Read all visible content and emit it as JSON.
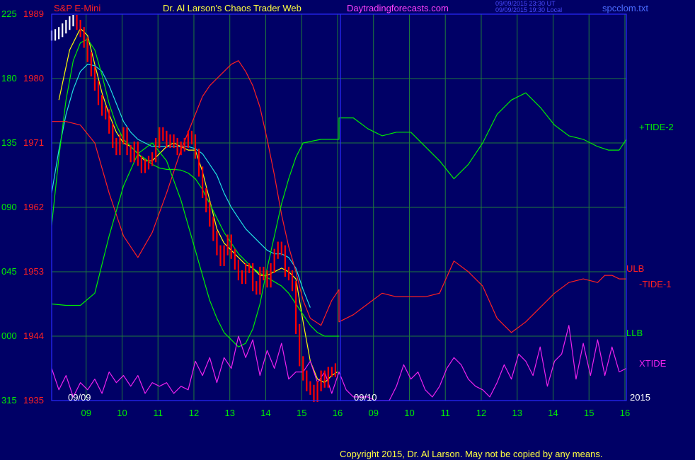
{
  "header": {
    "symbol": "S&P E-Mini",
    "author": "Dr. Al Larson's Chaos Trader Web",
    "site": "Daytradingforecasts.com",
    "stamp_line1": "09/09/2015 23:30 UT",
    "stamp_line2": "09/09/2015 19:30 Local",
    "file": "spcclom.txt"
  },
  "footer": {
    "copyright": "Copyright 2015, Dr. Al Larson. May not be copied by any means."
  },
  "chart_data": {
    "type": "line",
    "title": "Dr. Al Larson's Chaos Trader Web",
    "subtitle": "S&P E-Mini",
    "y_left_ticks": [
      "225",
      "180",
      "135",
      "090",
      "045",
      "000",
      "315"
    ],
    "y_price_ticks": [
      "1989",
      "1980",
      "1971",
      "1962",
      "1953",
      "1944",
      "1935"
    ],
    "price_range": [
      1935,
      1989
    ],
    "x_ticks": [
      "09",
      "10",
      "11",
      "12",
      "13",
      "14",
      "15",
      "16",
      "09",
      "10",
      "11",
      "12",
      "13",
      "14",
      "15",
      "16"
    ],
    "date_labels": [
      "09/09",
      "09/10"
    ],
    "year_label": "2015",
    "right_labels": [
      {
        "text": "+TIDE-2",
        "color": "#00ee00"
      },
      {
        "text": "ULB",
        "color": "#ff2020"
      },
      {
        "text": "-TIDE-1",
        "color": "#ff2020"
      },
      {
        "text": "LLB",
        "color": "#00ee00"
      },
      {
        "text": "XTIDE",
        "color": "#ee22ee"
      }
    ],
    "colors": {
      "background": "#000066",
      "plot_border": "#2a2aff",
      "grid": "#1f7a3c",
      "axis_text": "#00ee00",
      "price_text": "#ff2020",
      "header_text": "#ffff40",
      "site_text": "#ff40ff",
      "stamp_text": "#4a4aff",
      "file_text": "#4a6aff",
      "footer_text": "#ffff40",
      "bars_up": "#ffffff",
      "bars_down": "#ff0000"
    },
    "series": [
      {
        "name": "Price",
        "color": "#ff0000",
        "x": [
          0.0,
          0.1,
          0.2,
          0.3,
          0.4,
          0.5,
          0.6,
          0.7,
          0.8,
          0.9,
          1.0,
          1.1,
          1.2,
          1.3,
          1.4,
          1.5,
          1.6,
          1.7,
          1.8,
          1.9,
          2.0,
          2.1,
          2.2,
          2.3,
          2.4,
          2.5,
          2.6,
          2.7,
          2.8,
          2.9,
          3.0,
          3.1,
          3.2,
          3.3,
          3.4,
          3.5,
          3.6,
          3.7,
          3.8,
          3.9,
          4.0,
          4.1,
          4.2,
          4.3,
          4.4,
          4.5,
          4.6,
          4.7,
          4.8,
          4.9,
          5.0,
          5.1,
          5.2,
          5.3,
          5.4,
          5.5,
          5.6,
          5.7,
          5.8,
          5.9,
          6.0,
          6.1,
          6.2,
          6.3,
          6.4,
          6.5,
          6.6,
          6.7,
          6.8,
          6.9,
          7.0,
          7.1,
          7.2,
          7.3,
          7.4,
          7.5,
          7.6,
          7.7,
          7.8,
          7.9
        ],
        "y": [
          1986.0,
          1986.2,
          1986.5,
          1987.0,
          1987.5,
          1988.0,
          1988.2,
          1987.5,
          1986.5,
          1985.0,
          1983.0,
          1981.0,
          1979.0,
          1977.0,
          1975.5,
          1975.0,
          1973.0,
          1971.0,
          1970.0,
          1971.5,
          1972.5,
          1970.0,
          1969.0,
          1970.5,
          1968.5,
          1967.5,
          1968.0,
          1968.5,
          1969.0,
          1971.0,
          1972.5,
          1972.0,
          1971.0,
          1971.5,
          1971.0,
          1970.0,
          1970.5,
          1971.0,
          1972.0,
          1971.5,
          1969.5,
          1967.0,
          1964.0,
          1962.0,
          1960.0,
          1958.0,
          1956.0,
          1954.5,
          1956.0,
          1957.5,
          1955.5,
          1954.0,
          1952.5,
          1952.0,
          1953.5,
          1953.5,
          1951.0,
          1950.5,
          1953.0,
          1952.5,
          1951.5,
          1953.5,
          1955.5,
          1956.5,
          1956.0,
          1953.0,
          1952.5,
          1951.0,
          1945.0,
          1940.5,
          1938.5,
          1937.0,
          1936.5,
          1935.5,
          1937.0,
          1938.5,
          1937.5,
          1939.0,
          1939.0,
          1939.5
        ]
      },
      {
        "name": "Fast average",
        "color": "#ffff00",
        "x": [
          0.2,
          0.5,
          0.8,
          1.0,
          1.2,
          1.4,
          1.6,
          1.8,
          2.0,
          2.2,
          2.4,
          2.6,
          2.8,
          3.0,
          3.2,
          3.4,
          3.6,
          3.8,
          4.0,
          4.2,
          4.4,
          4.6,
          4.8,
          5.0,
          5.2,
          5.4,
          5.6,
          5.8,
          6.0,
          6.2,
          6.4,
          6.6,
          6.8,
          7.0,
          7.2,
          7.4,
          7.6,
          7.8,
          7.95
        ],
        "y": [
          1977.0,
          1984.0,
          1987.0,
          1986.0,
          1982.0,
          1978.0,
          1975.0,
          1972.5,
          1971.0,
          1970.5,
          1969.5,
          1968.5,
          1968.5,
          1969.5,
          1970.5,
          1971.0,
          1970.5,
          1970.0,
          1970.0,
          1967.0,
          1963.0,
          1959.0,
          1957.0,
          1956.0,
          1955.0,
          1954.0,
          1953.5,
          1952.5,
          1952.5,
          1953.0,
          1953.5,
          1953.0,
          1952.0,
          1946.0,
          1940.5,
          1938.0,
          1937.5,
          1938.5,
          1939.0
        ]
      },
      {
        "name": "Cyan average",
        "color": "#20e0e0",
        "x": [
          0.0,
          0.2,
          0.4,
          0.6,
          0.8,
          1.0,
          1.2,
          1.4,
          1.6,
          1.8,
          2.0,
          2.2,
          2.4,
          2.6,
          2.8,
          3.0,
          3.2,
          3.4,
          3.6,
          3.8,
          4.0,
          4.2,
          4.4,
          4.6,
          4.8,
          5.0,
          5.2,
          5.4,
          5.6,
          5.8,
          6.0,
          6.2,
          6.4,
          6.6,
          6.8,
          7.0,
          7.2
        ],
        "y": [
          1964.0,
          1970.0,
          1975.0,
          1978.5,
          1981.0,
          1982.0,
          1981.8,
          1981.0,
          1979.0,
          1976.5,
          1974.0,
          1972.5,
          1971.5,
          1971.0,
          1970.5,
          1970.5,
          1970.5,
          1970.5,
          1970.5,
          1970.5,
          1970.2,
          1969.5,
          1968.0,
          1966.5,
          1964.0,
          1962.0,
          1960.5,
          1959.0,
          1958.0,
          1957.0,
          1956.0,
          1955.5,
          1955.5,
          1955.0,
          1953.5,
          1950.5,
          1948.0
        ]
      },
      {
        "name": "Slow average",
        "color": "#00ee00",
        "x": [
          0.0,
          0.2,
          0.4,
          0.6,
          0.8,
          1.0,
          1.2,
          1.4,
          1.6,
          1.8,
          2.0,
          2.2,
          2.4,
          2.6,
          2.8,
          3.0,
          3.2,
          3.4,
          3.6,
          3.8,
          4.0,
          4.2,
          4.4,
          4.6,
          4.8,
          5.0,
          5.2,
          5.4,
          5.6,
          5.8,
          6.0,
          6.2,
          6.4,
          6.6,
          6.8,
          7.0,
          7.2,
          7.4,
          7.6,
          7.8,
          8.0
        ],
        "y": [
          1959.5,
          1969.0,
          1977.0,
          1982.5,
          1985.0,
          1985.5,
          1984.0,
          1980.5,
          1976.5,
          1973.5,
          1971.5,
          1970.5,
          1969.5,
          1968.8,
          1968.0,
          1967.5,
          1967.3,
          1967.3,
          1967.2,
          1966.8,
          1966.0,
          1964.5,
          1962.5,
          1960.5,
          1958.5,
          1957.0,
          1955.5,
          1954.5,
          1953.5,
          1952.8,
          1952.2,
          1951.6,
          1951.0,
          1950.0,
          1948.5,
          1947.0,
          1945.5,
          1944.5,
          1944.0,
          1944.0,
          1944.0
        ]
      },
      {
        "name": "-TIDE-1",
        "color": "#ff2020",
        "x": [
          0.0,
          0.4,
          0.8,
          1.2,
          1.6,
          2.0,
          2.4,
          2.8,
          3.2,
          3.6,
          4.0,
          4.2,
          4.4,
          4.6,
          4.8,
          5.0,
          5.2,
          5.4,
          5.6,
          5.8,
          6.0,
          6.2,
          6.4,
          6.6,
          6.8,
          7.0,
          7.2,
          7.5,
          7.8,
          8.0,
          8.0,
          8.4,
          8.8,
          9.2,
          9.6,
          10.0,
          10.4,
          10.8,
          11.2,
          11.6,
          12.0,
          12.4,
          12.8,
          13.2,
          13.6,
          14.0,
          14.4,
          14.8,
          15.2,
          15.4,
          15.6,
          15.8,
          16.0
        ],
        "y": [
          1974.0,
          1974.0,
          1973.5,
          1971.0,
          1964.0,
          1958.0,
          1955.0,
          1958.5,
          1964.0,
          1970.0,
          1975.0,
          1977.5,
          1979.0,
          1980.0,
          1981.0,
          1982.0,
          1982.5,
          1981.0,
          1979.0,
          1976.0,
          1971.5,
          1966.5,
          1961.0,
          1956.5,
          1953.0,
          1949.0,
          1946.5,
          1945.5,
          1949.0,
          1950.5,
          1946.0,
          1947.0,
          1948.5,
          1950.0,
          1949.5,
          1949.5,
          1949.5,
          1950.0,
          1954.5,
          1953.0,
          1951.0,
          1946.5,
          1944.5,
          1946.0,
          1948.0,
          1950.0,
          1951.5,
          1952.0,
          1951.5,
          1952.5,
          1952.5,
          1952.0,
          1952.0
        ]
      },
      {
        "name": "+TIDE-2",
        "color": "#00ee00",
        "x": [
          0.0,
          0.4,
          0.8,
          1.2,
          1.6,
          2.0,
          2.4,
          2.8,
          3.2,
          3.6,
          4.0,
          4.2,
          4.4,
          4.6,
          4.8,
          5.0,
          5.2,
          5.4,
          5.6,
          5.8,
          6.0,
          6.2,
          6.4,
          6.6,
          6.8,
          7.0,
          7.5,
          7.9,
          8.0,
          8.0,
          8.4,
          8.8,
          9.2,
          9.6,
          10.0,
          10.4,
          10.8,
          11.2,
          11.6,
          12.0,
          12.4,
          12.8,
          13.2,
          13.6,
          14.0,
          14.4,
          14.8,
          15.2,
          15.5,
          15.8,
          16.0
        ],
        "y": [
          1948.5,
          1948.3,
          1948.3,
          1950.0,
          1958.0,
          1965.0,
          1969.5,
          1971.0,
          1968.5,
          1963.0,
          1956.0,
          1952.5,
          1949.0,
          1946.5,
          1944.5,
          1943.5,
          1942.5,
          1943.0,
          1945.0,
          1948.5,
          1953.5,
          1958.0,
          1962.5,
          1966.0,
          1969.0,
          1971.0,
          1971.5,
          1971.5,
          1971.5,
          1974.5,
          1974.5,
          1973.0,
          1972.0,
          1972.5,
          1972.5,
          1970.5,
          1968.5,
          1966.0,
          1968.0,
          1971.0,
          1975.0,
          1977.0,
          1978.0,
          1976.0,
          1973.5,
          1972.0,
          1971.5,
          1970.5,
          1970.0,
          1970.0,
          1971.5
        ]
      },
      {
        "name": "XTIDE",
        "color": "#ee22ee",
        "x": [
          0.0,
          0.2,
          0.4,
          0.6,
          0.8,
          1.0,
          1.2,
          1.4,
          1.6,
          1.8,
          2.0,
          2.2,
          2.4,
          2.6,
          2.8,
          3.0,
          3.2,
          3.4,
          3.6,
          3.8,
          4.0,
          4.2,
          4.4,
          4.6,
          4.8,
          5.0,
          5.2,
          5.4,
          5.6,
          5.8,
          6.0,
          6.2,
          6.4,
          6.6,
          6.8,
          7.0,
          7.2,
          7.4,
          7.6,
          7.8,
          8.0,
          8.2,
          8.4,
          8.6,
          8.8,
          9.0,
          9.2,
          9.4,
          9.6,
          9.8,
          10.0,
          10.2,
          10.4,
          10.6,
          10.8,
          11.0,
          11.2,
          11.4,
          11.6,
          11.8,
          12.0,
          12.2,
          12.4,
          12.6,
          12.8,
          13.0,
          13.2,
          13.4,
          13.6,
          13.8,
          14.0,
          14.2,
          14.4,
          14.6,
          14.8,
          15.0,
          15.2,
          15.4,
          15.6,
          15.8,
          16.0
        ],
        "y": [
          1939.5,
          1936.5,
          1938.5,
          1935.5,
          1937.5,
          1936.5,
          1938.0,
          1936.0,
          1939.0,
          1937.5,
          1938.5,
          1937.0,
          1938.5,
          1936.0,
          1937.5,
          1937.0,
          1937.5,
          1936.0,
          1937.0,
          1936.5,
          1940.5,
          1938.5,
          1941.0,
          1937.5,
          1941.0,
          1939.5,
          1944.0,
          1941.0,
          1943.5,
          1938.5,
          1942.0,
          1939.5,
          1943.0,
          1938.0,
          1939.0,
          1939.0,
          1940.5,
          1937.5,
          1939.0,
          1936.0,
          1939.0,
          1936.5,
          1935.5,
          1935.5,
          1935.5,
          1935.0,
          1935.0,
          1935.0,
          1937.0,
          1940.0,
          1938.0,
          1939.0,
          1936.5,
          1935.5,
          1937.0,
          1939.5,
          1941.0,
          1940.0,
          1938.0,
          1937.0,
          1936.5,
          1935.5,
          1937.5,
          1940.0,
          1938.0,
          1941.5,
          1940.5,
          1938.5,
          1942.5,
          1937.0,
          1940.5,
          1941.5,
          1945.5,
          1938.0,
          1943.0,
          1938.5,
          1943.5,
          1938.5,
          1942.5,
          1939.0,
          1939.5
        ]
      }
    ],
    "xlim": [
      0,
      16
    ],
    "ylim": [
      1935,
      1989
    ]
  }
}
